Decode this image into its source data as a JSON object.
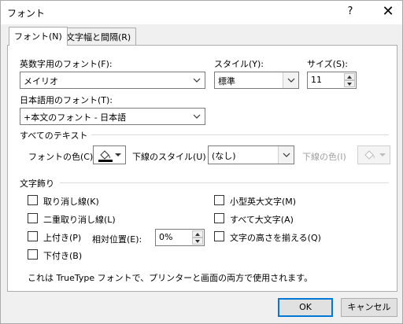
{
  "window": {
    "title": "フォント",
    "help": "?",
    "close": "✕"
  },
  "tabs": [
    {
      "label": "フォント(N)"
    },
    {
      "label": "文字幅と間隔(R)"
    }
  ],
  "latin_font": {
    "label": "英数字用のフォント(F):",
    "value": "メイリオ"
  },
  "style": {
    "label": "スタイル(Y):",
    "value": "標準"
  },
  "size": {
    "label": "サイズ(S):",
    "value": "11"
  },
  "asian_font": {
    "label": "日本語用のフォント(T):",
    "value": "+本文のフォント - 日本語"
  },
  "all_text": {
    "header": "すべてのテキスト",
    "font_color_label": "フォントの色(C)",
    "underline_style_label": "下線のスタイル(U)",
    "underline_style_value": "(なし)",
    "underline_color_label": "下線の色(I)",
    "font_color_hex": "#000000"
  },
  "effects": {
    "header": "文字飾り",
    "strikethrough": "取り消し線(K)",
    "double_strikethrough": "二重取り消し線(L)",
    "superscript": "上付き(P)",
    "subscript": "下付き(B)",
    "offset_label": "相対位置(E):",
    "offset_value": "0%",
    "small_caps": "小型英大文字(M)",
    "all_caps": "すべて大文字(A)",
    "equalize_height": "文字の高さを揃える(Q)"
  },
  "note": "これは TrueType フォントで、プリンターと画面の両方で使用されます。",
  "buttons": {
    "ok": "OK",
    "cancel": "キャンセル"
  },
  "colors": {
    "accent": "#0078d7",
    "border": "#7a7a7a"
  }
}
